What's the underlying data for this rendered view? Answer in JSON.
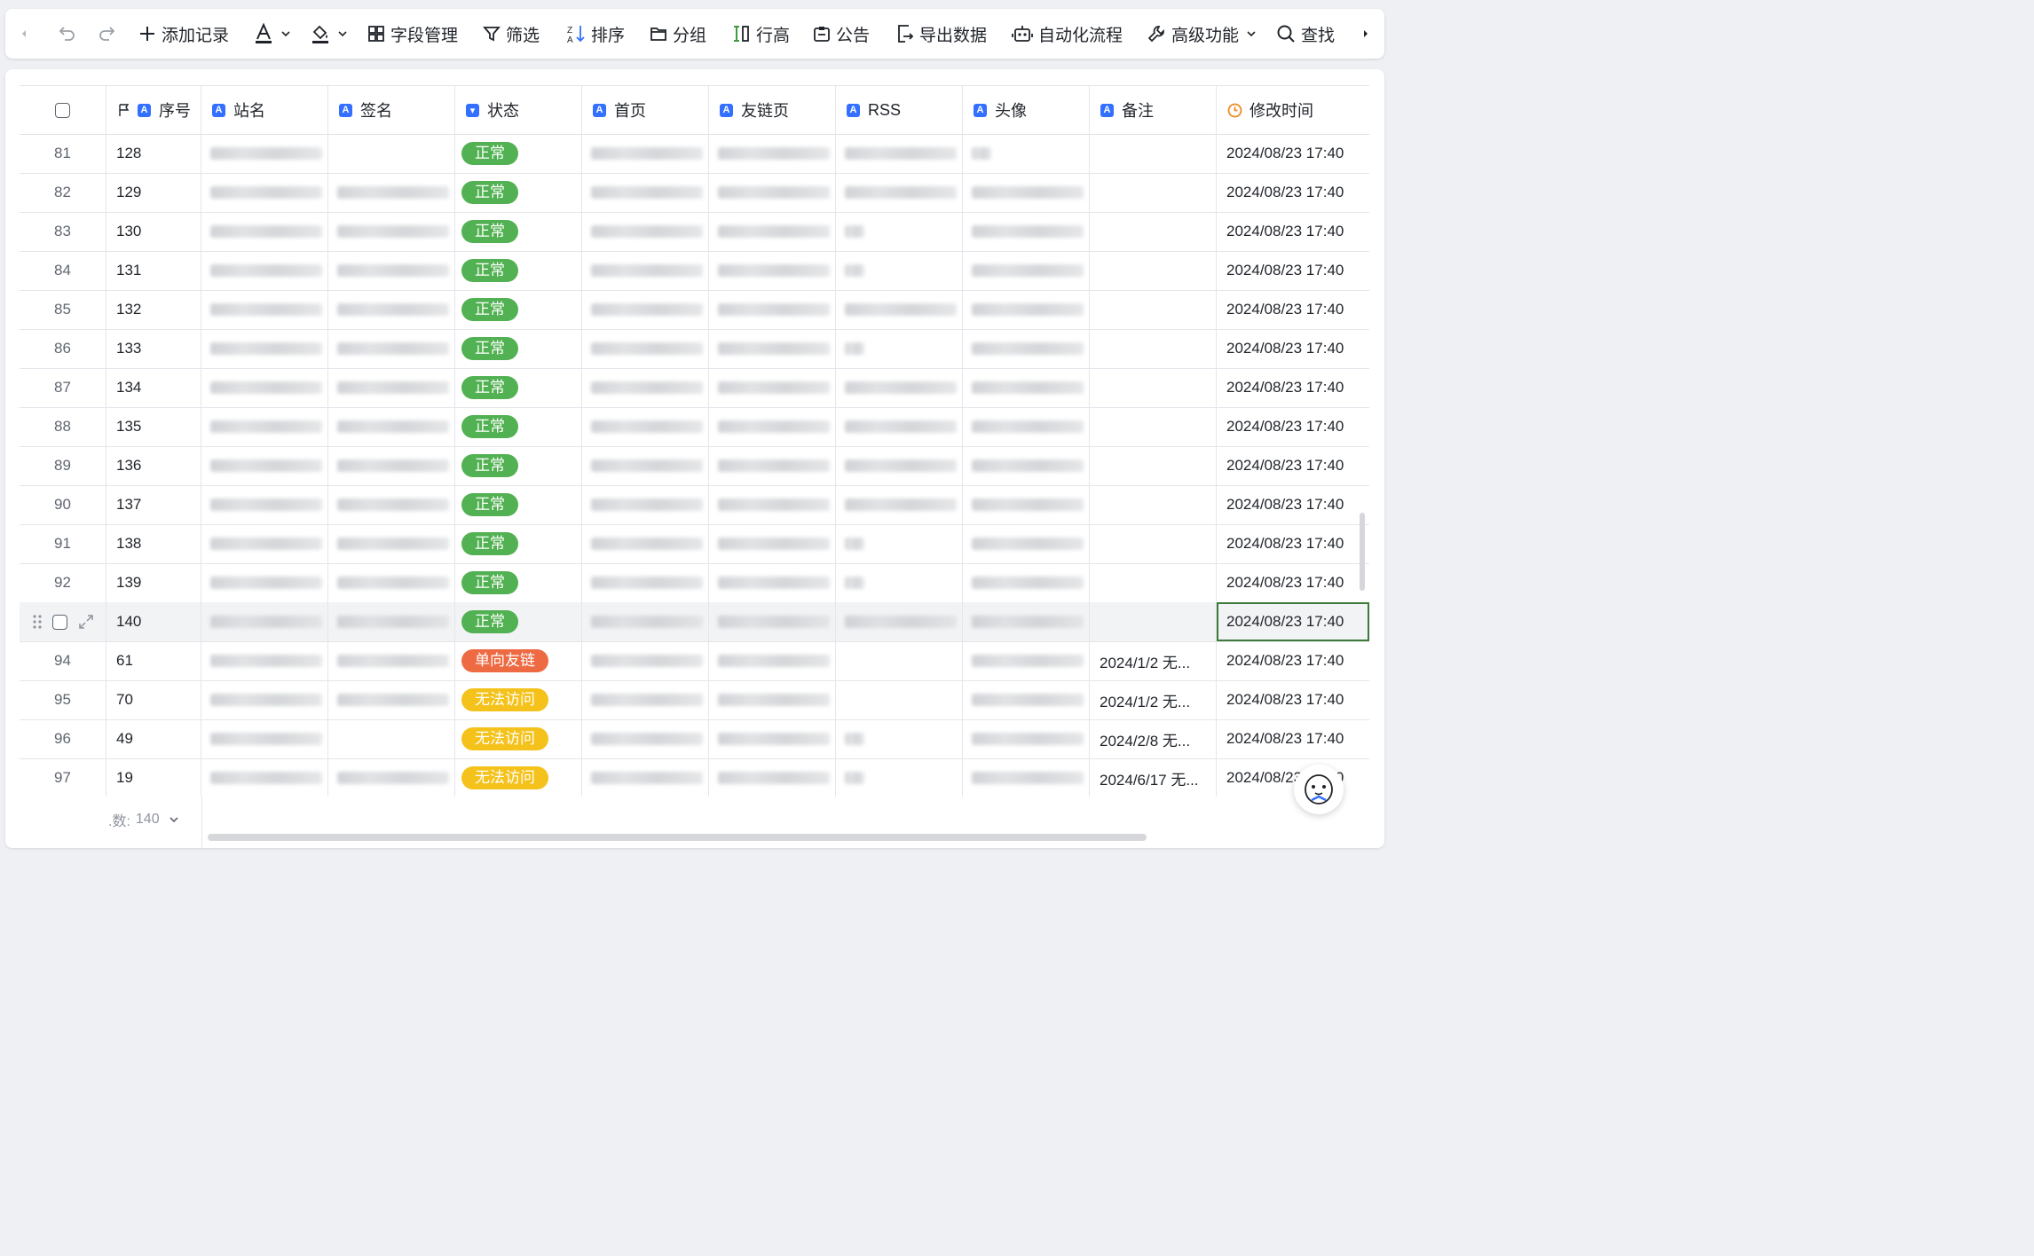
{
  "toolbar": {
    "add_record": "添加记录",
    "field_manage": "字段管理",
    "filter": "筛选",
    "sort": "排序",
    "group": "分组",
    "row_height": "行高",
    "notice": "公告",
    "export": "导出数据",
    "automation": "自动化流程",
    "advanced": "高级功能",
    "search": "查找"
  },
  "columns": {
    "seq": "序号",
    "site_name": "站名",
    "signature": "签名",
    "status": "状态",
    "homepage": "首页",
    "links_page": "友链页",
    "rss": "RSS",
    "avatar": "头像",
    "note": "备注",
    "modified": "修改时间"
  },
  "status_colors": {
    "正常": "#52b152",
    "单向友链": "#ee6a43",
    "无法访问": "#f4c21b"
  },
  "accent_color": "#3370ff",
  "rows": [
    {
      "row": "81",
      "seq": "128",
      "status": "正常",
      "note": "",
      "modified": "2024/08/23 17:40",
      "blur": [
        1,
        0,
        1,
        1,
        1,
        2,
        1
      ]
    },
    {
      "row": "82",
      "seq": "129",
      "status": "正常",
      "note": "",
      "modified": "2024/08/23 17:40",
      "blur": [
        1,
        1,
        1,
        1,
        1,
        1,
        1
      ]
    },
    {
      "row": "83",
      "seq": "130",
      "status": "正常",
      "note": "",
      "modified": "2024/08/23 17:40",
      "blur": [
        1,
        1,
        1,
        1,
        2,
        1,
        1
      ]
    },
    {
      "row": "84",
      "seq": "131",
      "status": "正常",
      "note": "",
      "modified": "2024/08/23 17:40",
      "blur": [
        1,
        1,
        1,
        1,
        2,
        1,
        1
      ]
    },
    {
      "row": "85",
      "seq": "132",
      "status": "正常",
      "note": "",
      "modified": "2024/08/23 17:40",
      "blur": [
        1,
        1,
        1,
        1,
        1,
        1,
        1
      ]
    },
    {
      "row": "86",
      "seq": "133",
      "status": "正常",
      "note": "",
      "modified": "2024/08/23 17:40",
      "blur": [
        1,
        1,
        1,
        1,
        2,
        1,
        1
      ]
    },
    {
      "row": "87",
      "seq": "134",
      "status": "正常",
      "note": "",
      "modified": "2024/08/23 17:40",
      "blur": [
        1,
        1,
        1,
        1,
        1,
        1,
        1
      ]
    },
    {
      "row": "88",
      "seq": "135",
      "status": "正常",
      "note": "",
      "modified": "2024/08/23 17:40",
      "blur": [
        1,
        1,
        1,
        1,
        1,
        1,
        1
      ]
    },
    {
      "row": "89",
      "seq": "136",
      "status": "正常",
      "note": "",
      "modified": "2024/08/23 17:40",
      "blur": [
        1,
        1,
        1,
        1,
        1,
        1,
        1
      ]
    },
    {
      "row": "90",
      "seq": "137",
      "status": "正常",
      "note": "",
      "modified": "2024/08/23 17:40",
      "blur": [
        1,
        1,
        1,
        1,
        1,
        1,
        1
      ]
    },
    {
      "row": "91",
      "seq": "138",
      "status": "正常",
      "note": "",
      "modified": "2024/08/23 17:40",
      "blur": [
        1,
        1,
        1,
        1,
        2,
        1,
        1
      ]
    },
    {
      "row": "92",
      "seq": "139",
      "status": "正常",
      "note": "",
      "modified": "2024/08/23 17:40",
      "blur": [
        1,
        1,
        1,
        1,
        2,
        1,
        1
      ]
    },
    {
      "row": "",
      "seq": "140",
      "status": "正常",
      "note": "",
      "modified": "2024/08/23 17:40",
      "blur": [
        1,
        1,
        1,
        1,
        1,
        1,
        1
      ],
      "active": true
    },
    {
      "row": "94",
      "seq": "61",
      "status": "单向友链",
      "note": "2024/1/2 无...",
      "modified": "2024/08/23 17:40",
      "blur": [
        1,
        1,
        1,
        1,
        0,
        1,
        1
      ]
    },
    {
      "row": "95",
      "seq": "70",
      "status": "无法访问",
      "note": "2024/1/2 无...",
      "modified": "2024/08/23 17:40",
      "blur": [
        1,
        1,
        1,
        1,
        0,
        1,
        1
      ]
    },
    {
      "row": "96",
      "seq": "49",
      "status": "无法访问",
      "note": "2024/2/8 无...",
      "modified": "2024/08/23 17:40",
      "blur": [
        1,
        0,
        1,
        1,
        2,
        1,
        1
      ]
    },
    {
      "row": "97",
      "seq": "19",
      "status": "无法访问",
      "note": "2024/6/17 无...",
      "modified": "2024/08/23 17:40",
      "blur": [
        1,
        1,
        1,
        1,
        2,
        1,
        1
      ]
    }
  ],
  "footer": {
    "count_label": ".数:",
    "count_value": "140"
  }
}
